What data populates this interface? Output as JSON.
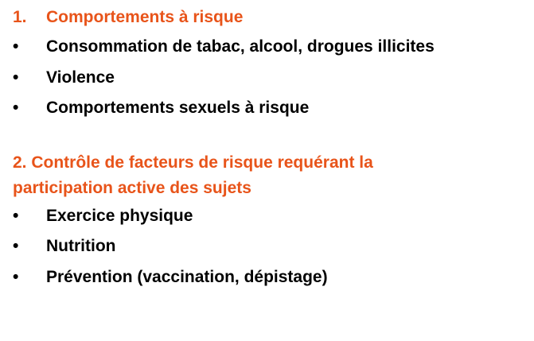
{
  "accent_color": "#e8541a",
  "section1": {
    "number": "1.",
    "heading": "Comportements à risque",
    "bullet_symbol": "•",
    "items": [
      "Consommation de tabac, alcool, drogues illicites",
      "Violence",
      "Comportements sexuels à risque"
    ]
  },
  "section2": {
    "heading_line1": "2. Contrôle de facteurs de risque requérant la",
    "heading_line2": "participation active des sujets",
    "bullet_symbol": "•",
    "items": [
      "Exercice physique",
      "Nutrition",
      "Prévention (vaccination, dépistage)"
    ]
  }
}
